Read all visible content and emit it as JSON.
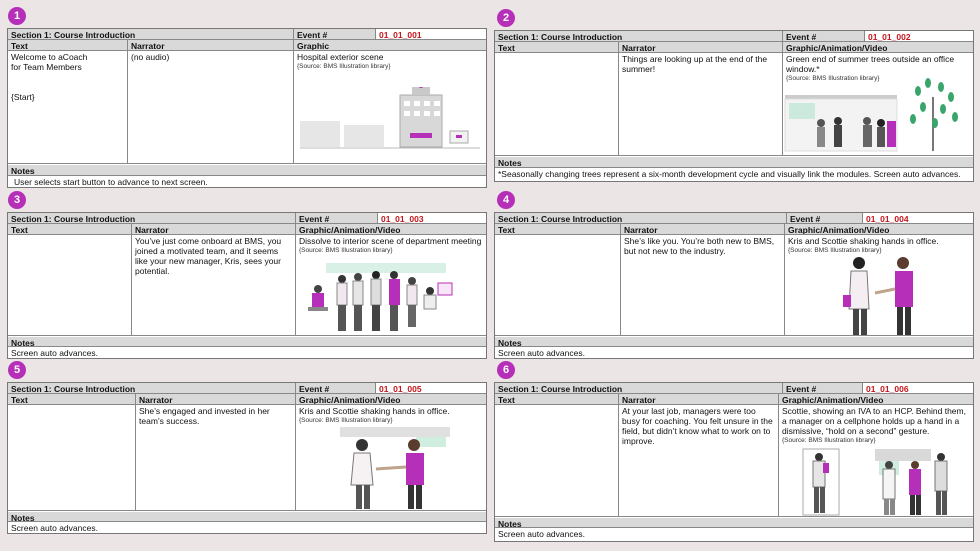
{
  "common": {
    "section": "Section 1: Course Introduction",
    "event_label": "Event #",
    "text_label": "Text",
    "narrator_label": "Narrator",
    "notes_label": "Notes",
    "source": "{Source: BMS Illustration library}"
  },
  "panels": [
    {
      "num": "1",
      "event": "01_01_001",
      "graphic_label": "Graphic",
      "text": [
        "Welcome to aCoach",
        "for Team Members",
        "",
        "",
        "{Start}"
      ],
      "narrator": "(no audio)",
      "graphic": "Hospital exterior scene",
      "notes": "User selects start button to advance to next screen."
    },
    {
      "num": "2",
      "event": "01_01_002",
      "graphic_label": "Graphic/Animation/Video",
      "text": [],
      "narrator": "Things are looking up at the end of the summer!",
      "graphic": "Green end of summer trees outside an office window.*",
      "notes": "*Seasonally changing trees represent a six-month development cycle and visually link the modules. Screen auto advances."
    },
    {
      "num": "3",
      "event": "01_01_003",
      "graphic_label": "Graphic/Animation/Video",
      "text": [],
      "narrator": "You’ve just come onboard at BMS, you joined a motivated team, and it seems like your new manager, Kris, sees your potential.",
      "graphic": "Dissolve to interior scene of department meeting",
      "notes": "Screen auto advances."
    },
    {
      "num": "4",
      "event": "01_01_004",
      "graphic_label": "Graphic/Animation/Video",
      "text": [],
      "narrator": "She’s like you. You’re both new to BMS, but not new to the industry.",
      "graphic": "Kris and Scottie shaking hands in office.",
      "notes": "Screen auto advances."
    },
    {
      "num": "5",
      "event": "01_01_005",
      "graphic_label": "Graphic/Animation/Video",
      "text": [],
      "narrator": "She’s engaged and invested in her team’s success.",
      "graphic": "Kris and Scottie shaking hands in office.",
      "notes": "Screen auto advances."
    },
    {
      "num": "6",
      "event": "01_01_006",
      "graphic_label": "Graphic/Animation/Video",
      "text": [],
      "narrator": "At your last job, managers were too busy for coaching. You felt unsure in the field, but didn’t know what to work on to improve.",
      "graphic": "Scottie, showing an IVA to an HCP. Behind them, a manager on a cellphone holds up a hand in a dismissive, “hold on a second” gesture.",
      "notes": "Screen auto advances."
    }
  ]
}
